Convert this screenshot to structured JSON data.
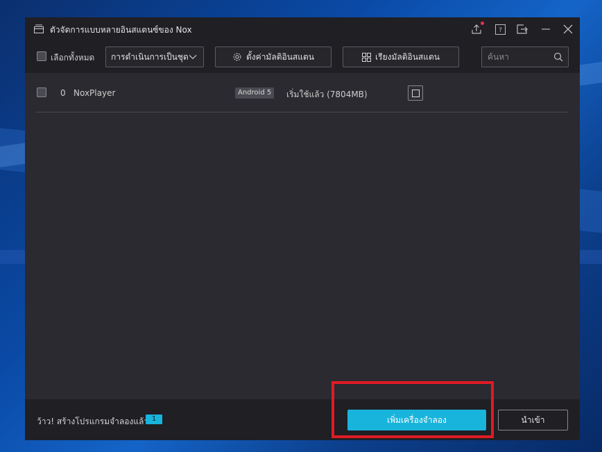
{
  "window": {
    "title": "ตัวจัดการแบบหลายอินสแตนซ์ของ Nox",
    "icons": [
      "multi-window-icon",
      "upload-icon",
      "help-icon",
      "export-icon",
      "minimize-icon",
      "close-icon"
    ],
    "notification_dot": true
  },
  "toolbar": {
    "select_all_label": "เลือกทั้งหมด",
    "batch_select_value": "การดำเนินการเป็นชุด",
    "settings_button": "ตั้งค่ามัลติอินสแตน",
    "arrange_button": "เรียงมัลติอินสแตน",
    "search_placeholder": "ค้นหา"
  },
  "instances": [
    {
      "index": "0",
      "name": "NoxPlayer",
      "android_version": "Android 5",
      "status": "เริ่มใช้แล้ว (7804MB)"
    }
  ],
  "footer": {
    "message": "ว้าว! สร้างโปรแกรมจำลองแล้ว:",
    "count": "1",
    "add_button": "เพิ่มเครื่องจำลอง",
    "import_button": "นำเข้า"
  },
  "colors": {
    "accent": "#18b4dc",
    "window_bg": "#2a2a30",
    "bar_bg": "#1f1f24",
    "highlight": "#e01b24",
    "notification": "#e5334a"
  }
}
